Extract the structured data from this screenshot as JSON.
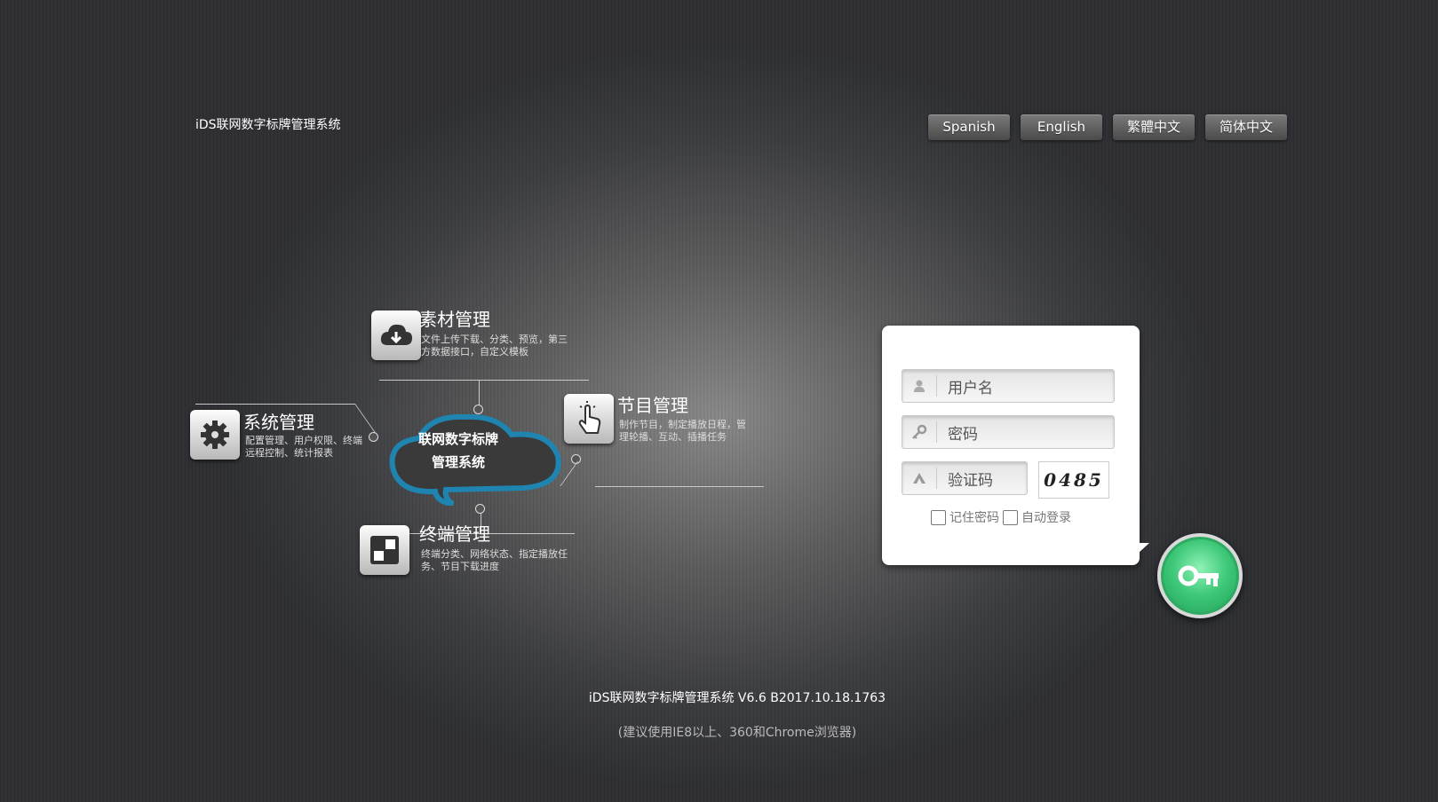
{
  "header": {
    "app_title": "iDS联网数字标牌管理系统"
  },
  "languages": [
    {
      "label": "Spanish"
    },
    {
      "label": "English"
    },
    {
      "label": "繁體中文"
    },
    {
      "label": "简体中文"
    }
  ],
  "diagram": {
    "center": {
      "line1": "联网数字标牌",
      "line2": "管理系统"
    },
    "modules": {
      "materials": {
        "title": "素材管理",
        "desc": "文件上传下载、分类、预览，第三方数据接口，自定义模板",
        "icon": "cloud-download-icon"
      },
      "system": {
        "title": "系统管理",
        "desc": "配置管理、用户权限、终端远程控制、统计报表",
        "icon": "gear-icon"
      },
      "program": {
        "title": "节目管理",
        "desc": "制作节目，制定播放日程，管理轮播、互动、插播任务",
        "icon": "touch-hand-icon"
      },
      "terminal": {
        "title": "终端管理",
        "desc": "终端分类、网络状态、指定播放任务、节目下载进度",
        "icon": "terminal-grid-icon"
      }
    }
  },
  "login": {
    "username_placeholder": "用户名",
    "password_placeholder": "密码",
    "captcha_placeholder": "验证码",
    "captcha_value": "0485",
    "remember_label": "记住密码",
    "autologin_label": "自动登录",
    "colors": {
      "button": "#3ec878"
    }
  },
  "footer": {
    "version": "iDS联网数字标牌管理系统 V6.6 B2017.10.18.1763",
    "hint": "(建议使用IE8以上、360和Chrome浏览器)"
  }
}
